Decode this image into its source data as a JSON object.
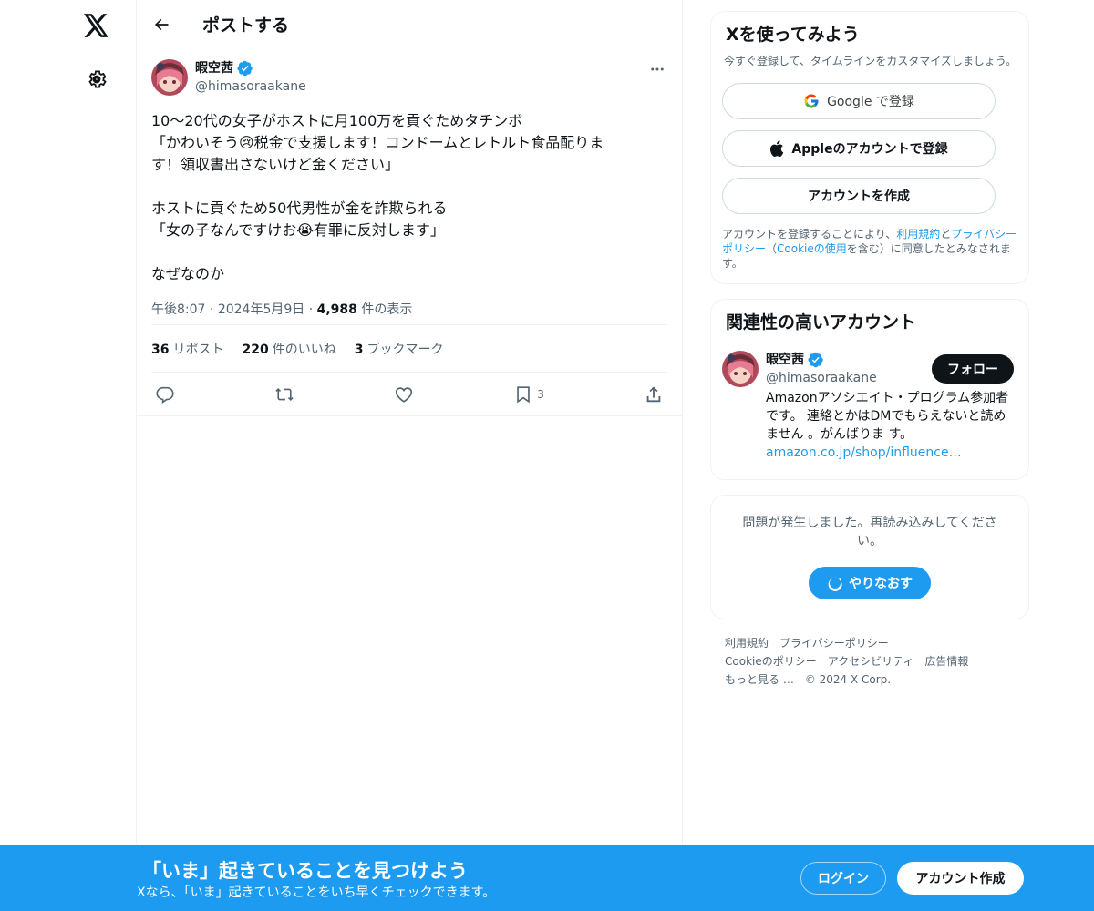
{
  "header": {
    "title": "ポストする"
  },
  "post": {
    "author_name": "暇空茜",
    "handle": "@himasoraakane",
    "body": "10〜20代の女子がホストに月100万を貢ぐためタチンボ\n「かわいそう😢税金で支援します！コンドームとレトルト食品配りま\nす！領収書出さないけど金ください」\n\nホストに貢ぐため50代男性が金を詐欺られる\n「女の子なんですけお😭有罪に反対します」\n\nなぜなのか",
    "time": "午後8:07",
    "date": "2024年5月9日",
    "views_count": "4,988",
    "views_label": "件の表示",
    "reposts_count": "36",
    "reposts_label": "リポスト",
    "likes_count": "220",
    "likes_label": "件のいいね",
    "bookmarks_count": "3",
    "bookmarks_label": "ブックマーク",
    "bookmark_action_count": "3"
  },
  "signup_card": {
    "title": "Xを使ってみよう",
    "subtitle": "今すぐ登録して、タイムラインをカスタマイズしましょう。",
    "google_label": "Google で登録",
    "apple_label": "Appleのアカウントで登録",
    "create_label": "アカウントを作成",
    "legal_1": "アカウントを登録することにより、",
    "legal_terms": "利用規約",
    "legal_2": "と",
    "legal_privacy": "プライバシーポリシー",
    "legal_3": "（",
    "legal_cookie": "Cookieの使用",
    "legal_4": "を含む）に同意したとみなされます。"
  },
  "related": {
    "title": "関連性の高いアカウント",
    "name": "暇空茜",
    "handle": "@himasoraakane",
    "follow_label": "フォロー",
    "bio": "Amazonアソシエイト・プログラム参加者です。 連絡とかはDMでもらえないと読めません 。がんばりま す。",
    "bio_link": "amazon.co.jp/shop/influence…"
  },
  "error_card": {
    "message": "問題が発生しました。再読み込みしてください。",
    "retry_label": "やりなおす"
  },
  "footer": {
    "terms": "利用規約",
    "privacy": "プライバシーポリシー",
    "cookie": "Cookieのポリシー",
    "accessibility": "アクセシビリティ",
    "ads": "広告情報",
    "more": "もっと見る …",
    "copyright": "© 2024 X Corp."
  },
  "bottom_bar": {
    "title": "「いま」起きていることを見つけよう",
    "subtitle": "Xなら、「いま」起きていることをいち早くチェックできます。",
    "login_label": "ログイン",
    "signup_label": "アカウント作成"
  },
  "colors": {
    "accent": "#1d9bf0",
    "text": "#0f1419",
    "secondary": "#536471"
  }
}
